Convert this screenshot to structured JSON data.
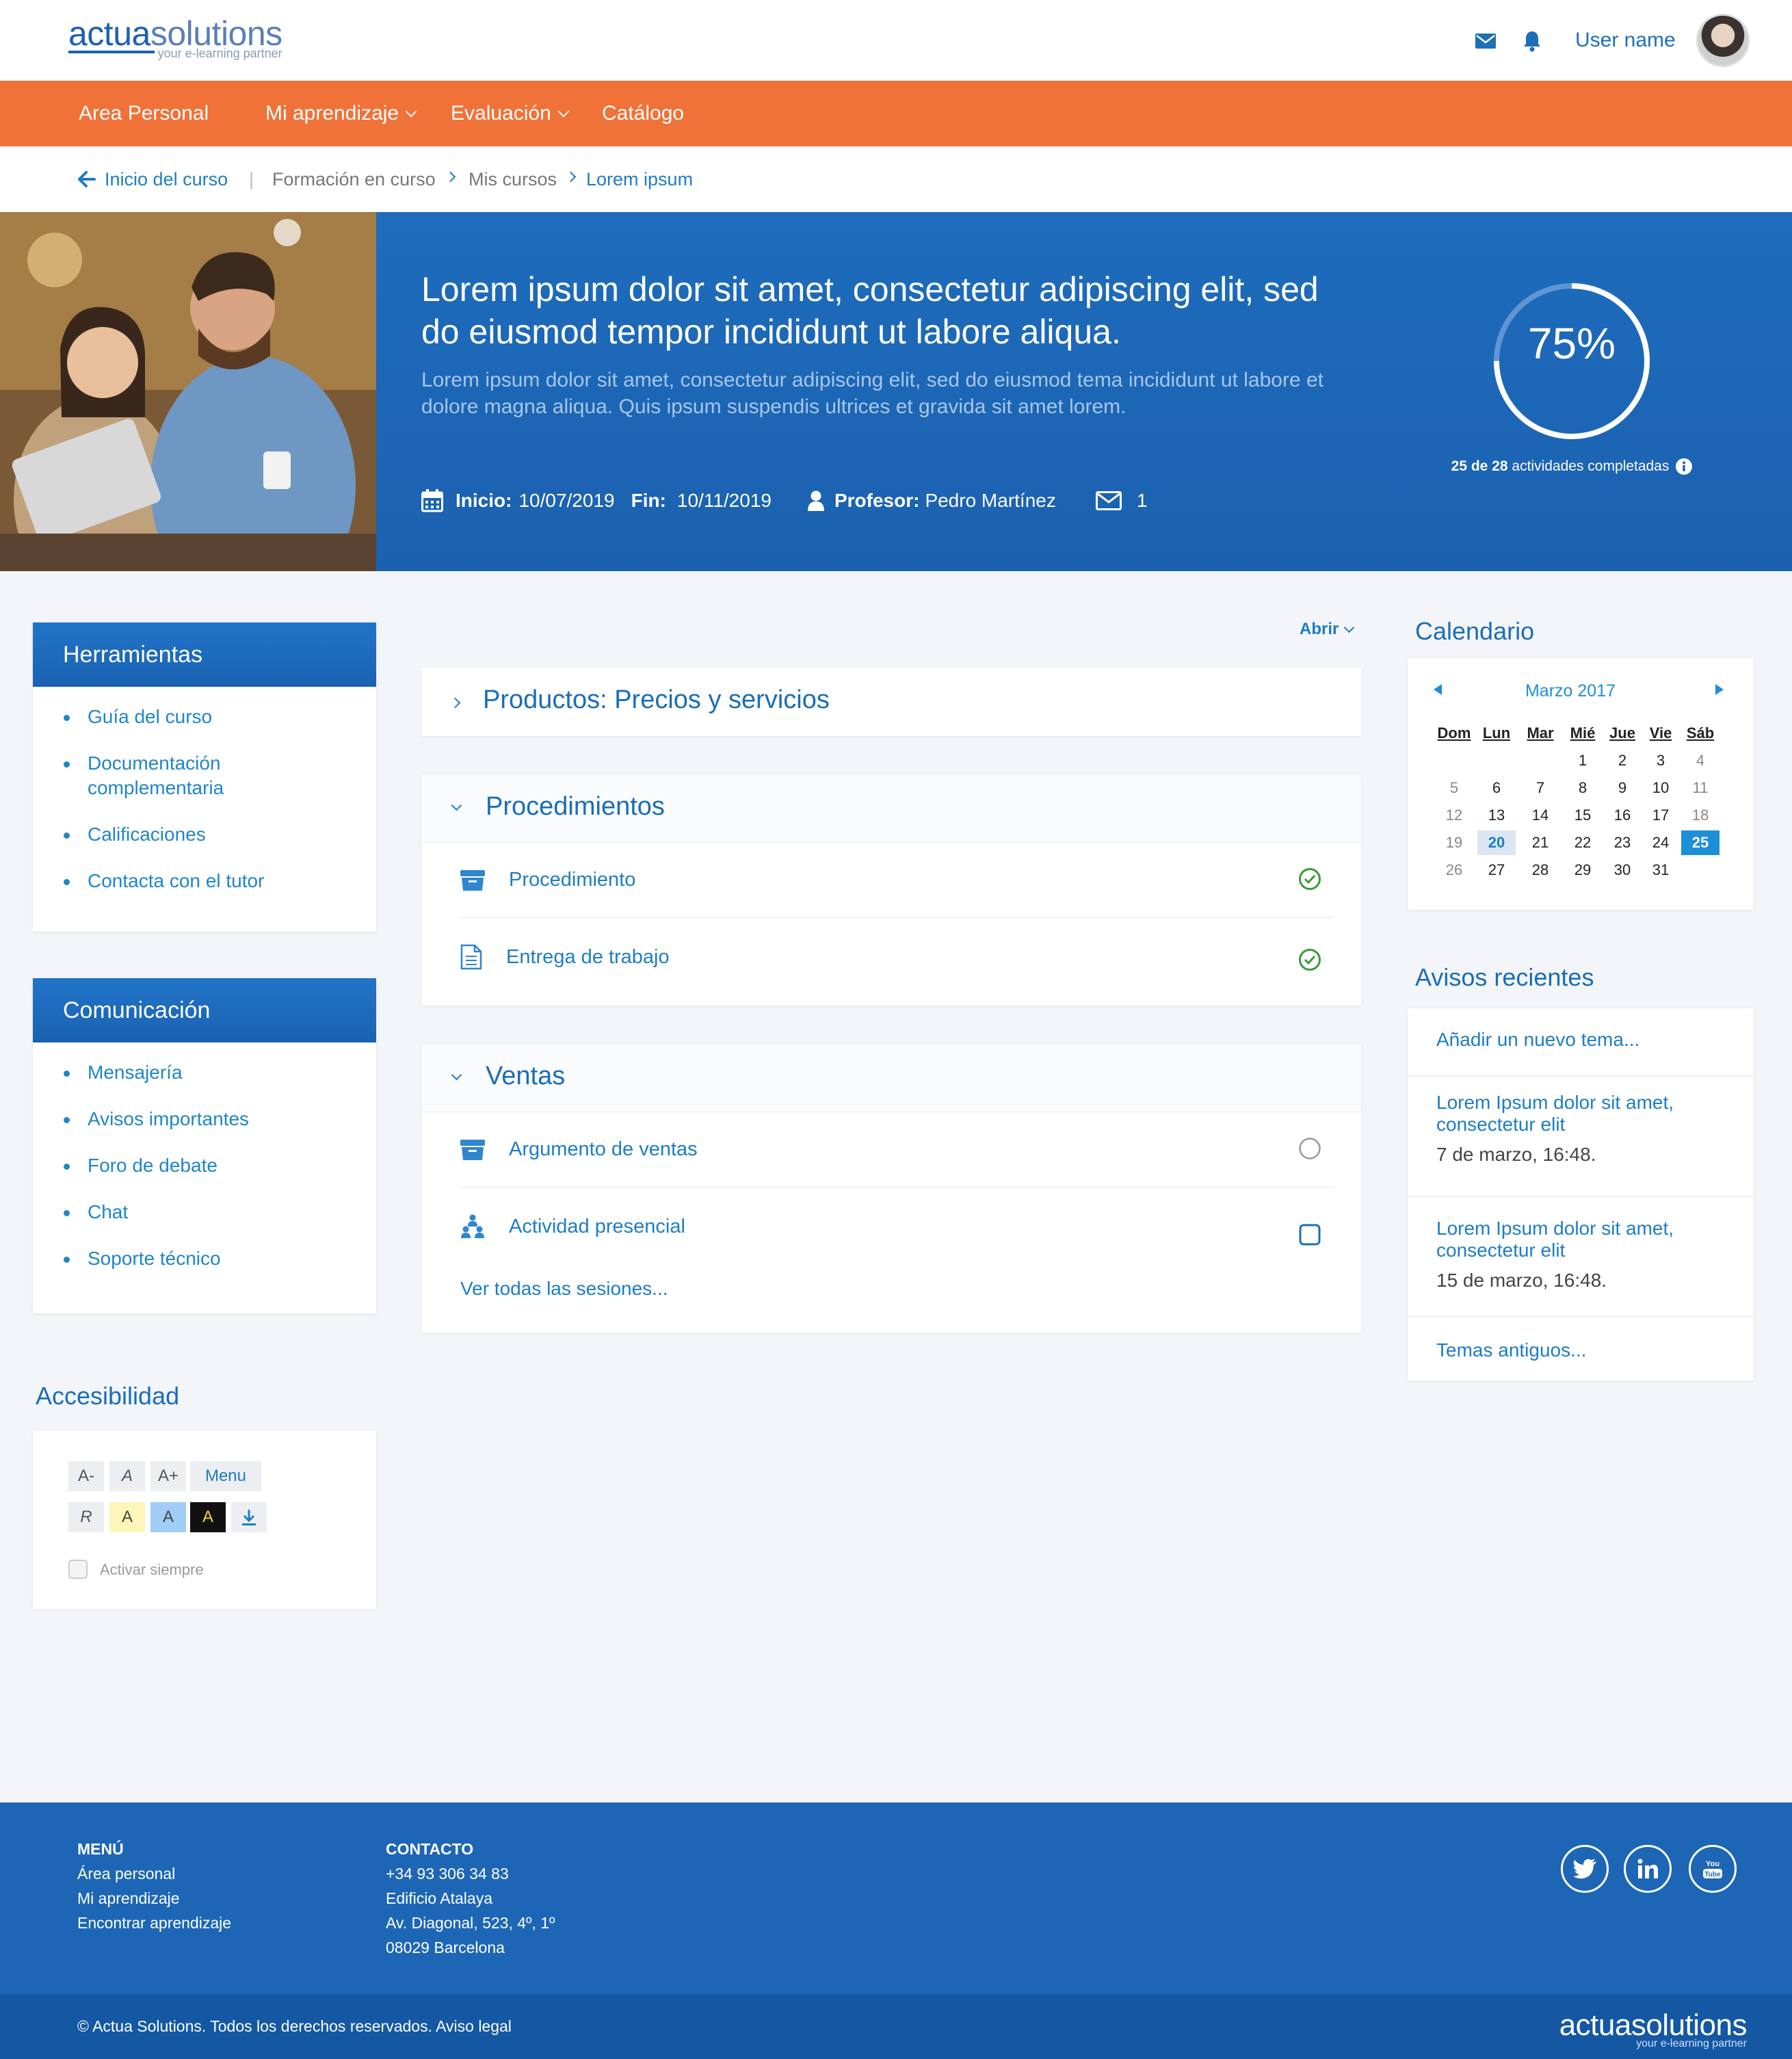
{
  "header": {
    "logo_brand_a": "actua",
    "logo_brand_b": "solutions",
    "logo_tagline": "your e-learning partner",
    "mail_icon": "envelope-icon",
    "bell_icon": "bell-icon",
    "user_name": "User name"
  },
  "nav": {
    "items": [
      {
        "label": "Area Personal"
      },
      {
        "label": "Mi aprendizaje"
      },
      {
        "label": "Evaluación"
      },
      {
        "label": "Catálogo"
      }
    ]
  },
  "breadcrumb": {
    "back": "Inicio del curso",
    "separator": "|",
    "items": [
      "Formación en curso",
      "Mis cursos",
      "Lorem ipsum"
    ]
  },
  "hero": {
    "title": "Lorem ipsum dolor sit amet, consectetur adipiscing elit, sed do eiusmod tempor incididunt ut labore aliqua.",
    "subtitle": "Lorem ipsum dolor sit amet, consectetur adipiscing elit, sed do eiusmod tema incididunt ut labore et dolore magna aliqua. Quis ipsum suspendis ultrices et gravida sit amet lorem.",
    "start_label": "Inicio:",
    "start_date": "10/07/2019",
    "end_label": "Fin:",
    "end_date": "10/11/2019",
    "teacher_label": "Profesor:",
    "teacher_name": "Pedro Martínez",
    "messages_count": "1",
    "progress_text": "75%",
    "progress_fraction": 0.75,
    "activities_bold": "25 de 28",
    "activities_text": "actividades completadas"
  },
  "tools": {
    "title": "Herramientas",
    "items": [
      "Guía del curso",
      "Documentación complementaria",
      "Calificaciones",
      "Contacta con el tutor"
    ]
  },
  "communication": {
    "title": "Comunicación",
    "items": [
      "Mensajería",
      "Avisos importantes",
      "Foro de debate",
      "Chat",
      "Soporte técnico"
    ]
  },
  "accessibility": {
    "title": "Accesibilidad",
    "row1": [
      "A-",
      "A",
      "A+",
      "Menu"
    ],
    "row2": [
      "R",
      "A",
      "A",
      "A"
    ],
    "always_label": "Activar siempre"
  },
  "content": {
    "open_label": "Abrir",
    "sections": [
      {
        "title": "Productos: Precios y servicios"
      },
      {
        "title": "Procedimientos",
        "items": [
          {
            "label": "Procedimiento",
            "icon": "box-icon",
            "status": "completed"
          },
          {
            "label": "Entrega de trabajo",
            "icon": "document-icon",
            "status": "completed"
          }
        ]
      },
      {
        "title": "Ventas",
        "items": [
          {
            "label": "Argumento de ventas",
            "icon": "box-icon",
            "status": "pending"
          },
          {
            "label": "Actividad presencial",
            "icon": "group-icon",
            "status": "unchecked"
          }
        ],
        "more_label": "Ver todas las sesiones..."
      }
    ]
  },
  "calendar": {
    "title": "Calendario",
    "month": "Marzo 2017",
    "weekdays": [
      "Dom",
      "Lun",
      "Mar",
      "Mié",
      "Jue",
      "Vie",
      "Sáb"
    ],
    "weeks": [
      [
        "",
        "",
        "",
        "1",
        "2",
        "3",
        "4"
      ],
      [
        "5",
        "6",
        "7",
        "8",
        "9",
        "10",
        "11"
      ],
      [
        "12",
        "13",
        "14",
        "15",
        "16",
        "17",
        "18"
      ],
      [
        "19",
        "20",
        "21",
        "22",
        "23",
        "24",
        "25"
      ],
      [
        "26",
        "27",
        "28",
        "29",
        "30",
        "31",
        ""
      ]
    ],
    "highlight_day": "20",
    "selected_day": "25"
  },
  "notices": {
    "title": "Avisos recientes",
    "add_label": "Añadir un nuevo tema...",
    "items": [
      {
        "title": "Lorem Ipsum dolor sit amet, consectetur elit",
        "date": "7 de marzo, 16:48."
      },
      {
        "title": "Lorem Ipsum dolor sit amet, consectetur elit",
        "date": "15 de marzo, 16:48."
      }
    ],
    "old_label": "Temas antiguos..."
  },
  "footer": {
    "menu_title": "MENÚ",
    "menu_items": [
      "Área personal",
      "Mi aprendizaje",
      "Encontrar aprendizaje"
    ],
    "contact_title": "CONTACTO",
    "contact_lines": [
      "+34 93 306 34 83",
      "Edificio Atalaya",
      "Av. Diagonal, 523, 4º, 1º",
      "08029 Barcelona"
    ],
    "social": [
      "twitter-icon",
      "linkedin-icon",
      "youtube-icon"
    ],
    "copyright": "© Actua Solutions. Todos los derechos reservados. Aviso legal",
    "logo_brand": "actuasolutions",
    "logo_tagline": "your e-learning partner"
  },
  "colors": {
    "primary": "#1d66b6",
    "accent": "#f07238",
    "link": "#1d7dc4",
    "success": "#3a9a3a"
  }
}
